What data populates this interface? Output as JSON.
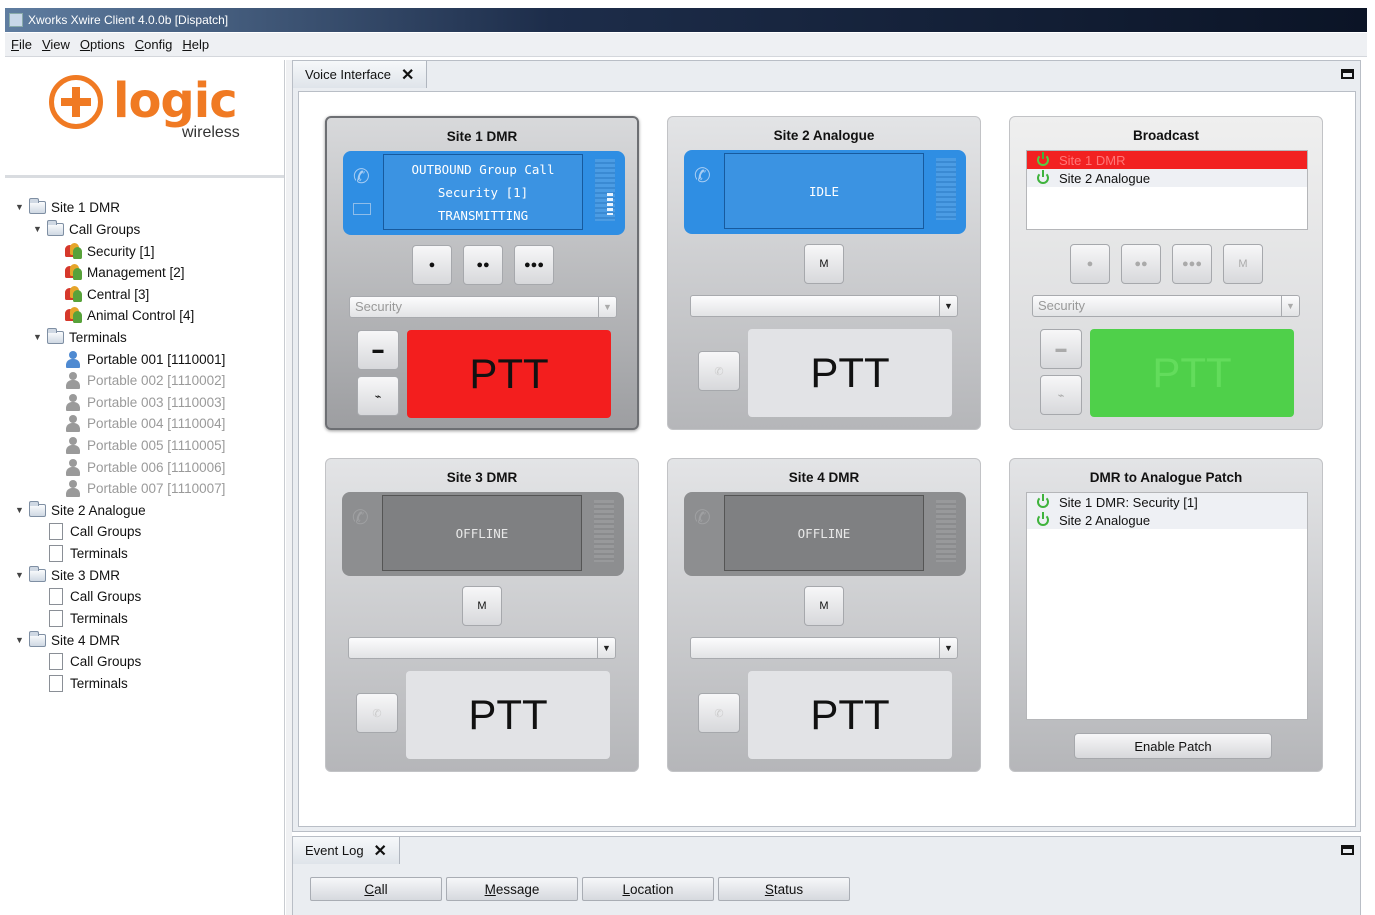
{
  "window": {
    "title": "Xworks Xwire Client 4.0.0b [Dispatch]"
  },
  "menu": [
    "File",
    "View",
    "Options",
    "Config",
    "Help"
  ],
  "logo": {
    "brand": "logic",
    "sub": "wireless"
  },
  "tree": {
    "site1": "Site 1 DMR",
    "site1_call_groups": "Call Groups",
    "groups": [
      "Security [1]",
      "Management [2]",
      "Central [3]",
      "Animal Control [4]"
    ],
    "site1_terminals": "Terminals",
    "terminals": [
      "Portable 001 [1110001]",
      "Portable 002 [1110002]",
      "Portable 003 [1110003]",
      "Portable 004 [1110004]",
      "Portable 005 [1110005]",
      "Portable 006 [1110006]",
      "Portable 007 [1110007]"
    ],
    "site2": "Site 2 Analogue",
    "site3": "Site 3 DMR",
    "site4": "Site 4 DMR",
    "call_groups": "Call Groups",
    "terminals_label": "Terminals"
  },
  "voice": {
    "tab": "Voice Interface",
    "panels": {
      "p1": {
        "title": "Site 1 DMR",
        "line1": "OUTBOUND Group Call",
        "line2": "Security [1]",
        "line3": "TRANSMITTING",
        "combo": "Security",
        "ptt": "PTT"
      },
      "p2": {
        "title": "Site 2 Analogue",
        "status": "IDLE",
        "m": "M",
        "ptt": "PTT"
      },
      "p3": {
        "title": "Broadcast",
        "items": [
          "Site 1 DMR",
          "Site 2 Analogue"
        ],
        "m": "M",
        "combo": "Security",
        "ptt": "PTT"
      },
      "p4": {
        "title": "Site 3 DMR",
        "status": "OFFLINE",
        "m": "M",
        "ptt": "PTT"
      },
      "p5": {
        "title": "Site 4 DMR",
        "status": "OFFLINE",
        "m": "M",
        "ptt": "PTT"
      },
      "p6": {
        "title": "DMR to Analogue Patch",
        "items": [
          "Site 1 DMR: Security [1]",
          "Site 2 Analogue"
        ],
        "button": "Enable Patch"
      }
    }
  },
  "event_log": {
    "tab": "Event Log",
    "buttons": [
      "Call",
      "Message",
      "Location",
      "Status"
    ]
  },
  "colors": {
    "accent_orange": "#f07a23",
    "ptt_red": "#f31e1e",
    "ptt_green": "#4fd04a",
    "screen_blue": "#2f8ee3"
  }
}
